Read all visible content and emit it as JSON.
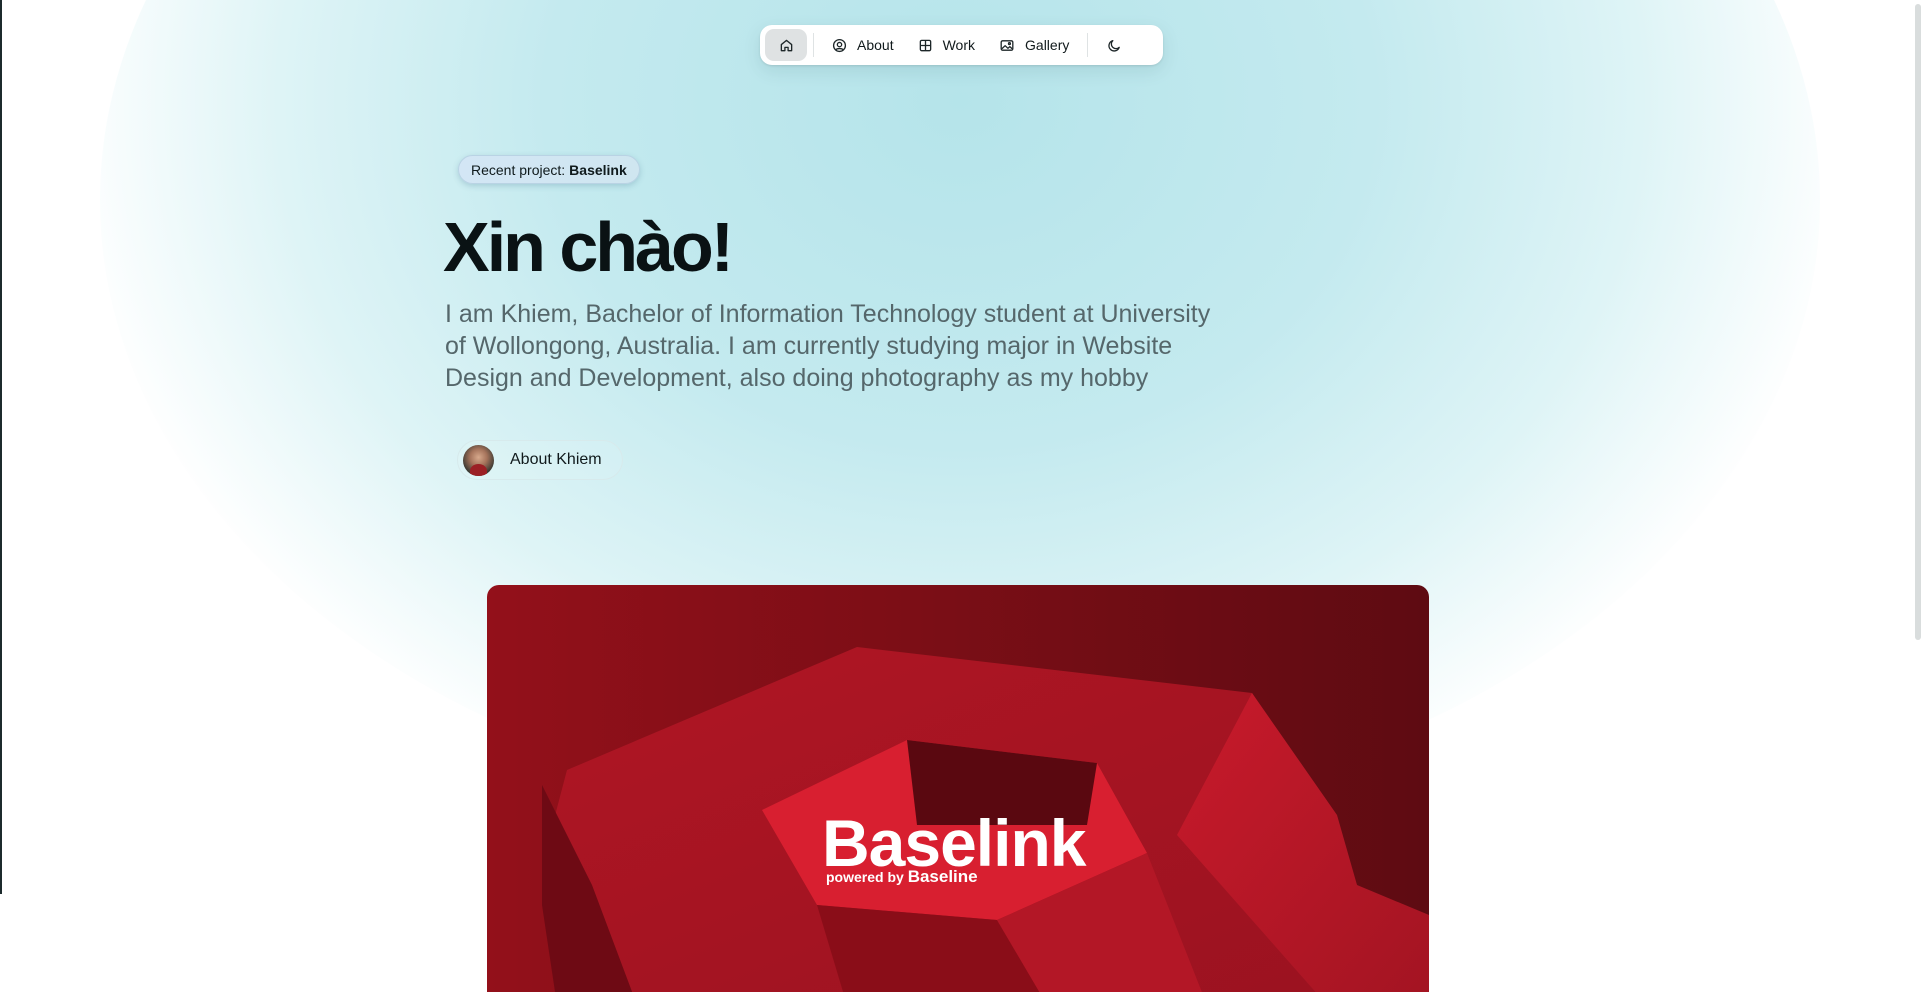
{
  "nav": {
    "items": [
      {
        "icon": "home-icon",
        "label": ""
      },
      {
        "icon": "user-circle-icon",
        "label": "About"
      },
      {
        "icon": "grid-icon",
        "label": "Work"
      },
      {
        "icon": "image-icon",
        "label": "Gallery"
      }
    ],
    "theme_icon": "moon-icon"
  },
  "badge": {
    "prefix": "Recent project:",
    "project": "Baselink"
  },
  "hero": {
    "title": "Xin chào!",
    "description": "I am Khiem, Bachelor of Information Technology student at University of Wollongong, Australia. I am currently studying major in Website Design and Development, also doing photography as my hobby"
  },
  "about_button": {
    "label": "About Khiem"
  },
  "project_card": {
    "title": "Baselink",
    "subtitle_prefix": "powered by",
    "subtitle_brand": "Baseline"
  },
  "colors": {
    "glow": "#b5e4ea",
    "card_red": "#93101a",
    "text_muted": "#55676b"
  }
}
